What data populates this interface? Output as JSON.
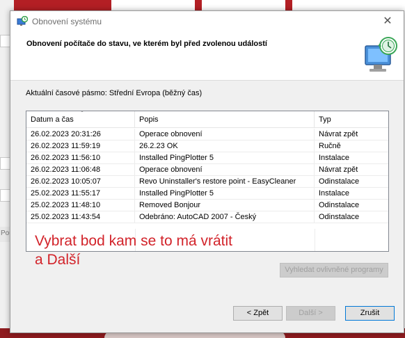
{
  "window": {
    "title": "Obnovení systému",
    "close_glyph": "✕"
  },
  "header": {
    "title": "Obnovení počítače do stavu, ve kterém byl před zvolenou událostí"
  },
  "timezone_text": "Aktuální časové pásmo: Střední Evropa (běžný čas)",
  "table": {
    "columns": [
      "Datum a čas",
      "Popis",
      "Typ"
    ],
    "rows": [
      {
        "date": "26.02.2023 20:31:26",
        "description": "Operace obnovení",
        "type": "Návrat zpět"
      },
      {
        "date": "26.02.2023 11:59:19",
        "description": "26.2.23 OK",
        "type": "Ručně"
      },
      {
        "date": "26.02.2023 11:56:10",
        "description": "Installed PingPlotter 5",
        "type": "Instalace"
      },
      {
        "date": "26.02.2023 11:06:48",
        "description": "Operace obnovení",
        "type": "Návrat zpět"
      },
      {
        "date": "26.02.2023 10:05:07",
        "description": "Revo Uninstaller's restore point - EasyCleaner",
        "type": "Odinstalace"
      },
      {
        "date": "25.02.2023 11:55:17",
        "description": "Installed PingPlotter 5",
        "type": "Instalace"
      },
      {
        "date": "25.02.2023 11:48:10",
        "description": "Removed Bonjour",
        "type": "Odinstalace"
      },
      {
        "date": "25.02.2023 11:43:54",
        "description": "Odebráno: AutoCAD 2007 - Český",
        "type": "Odinstalace"
      }
    ]
  },
  "annotation": {
    "line1": "Vybrat bod kam se to má vrátit",
    "line2": "a Další"
  },
  "buttons": {
    "affected": "Vyhledat ovlivněné programy",
    "back": "< Zpět",
    "next": "Další >",
    "cancel": "Zrušit"
  },
  "background": {
    "left_fragment": "Pou"
  },
  "colors": {
    "annotation": "#d2232a",
    "desktop": "#b31f24",
    "focus_border": "#0078d7"
  },
  "icons": {
    "title": "system-restore-icon",
    "header": "system-restore-computer-icon"
  }
}
